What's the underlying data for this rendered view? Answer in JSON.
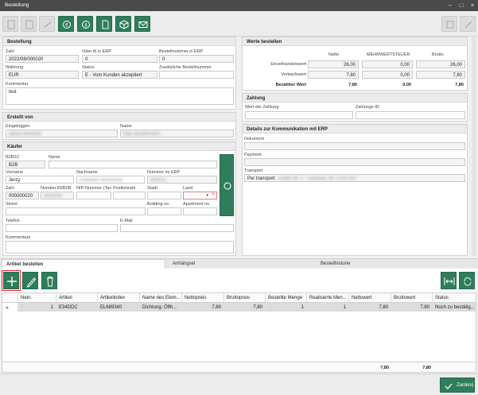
{
  "window": {
    "title": "Bestellung"
  },
  "bestellung": {
    "header": "Bestellung",
    "zahl_label": "Zahl",
    "zahl": "2022/08/000020",
    "order_id_label": "Oder Id in ERP",
    "order_id": "0",
    "bestellnummer_label": "Bestellnummer in ERP",
    "bestellnummer": "0",
    "waehrung_label": "Währung",
    "waehrung": "EUR",
    "status_label": "Status",
    "status": "E - Vom Kunden akzeptiert",
    "zusatz_label": "Zusätzliche Bestellnummer",
    "zusatz": "",
    "kommentar_label": "Kommentar",
    "kommentar": "test"
  },
  "erstellt": {
    "header": "Erstellt von",
    "eingeloggt_label": "Eingeloggen",
    "eingeloggt": "admin.benutzer",
    "name_label": "Name",
    "name": "Max Mustermann"
  },
  "kaeufer": {
    "header": "Käufer",
    "b2b_label": "B2B2C",
    "b2b": "B2B",
    "name_label": "Name",
    "name": "",
    "vorname_label": "Vorname",
    "vorname": "Jerzy",
    "nachname_label": "Nachname",
    "nachname": "Kowalski Nachname",
    "nummer_label": "Nummer im ERP",
    "nummer": "000001",
    "zahl_label": "Zahl",
    "zahl": "000000020",
    "number_b2b_label": "Number B2B2B",
    "number_b2b": "0000000",
    "nip_label": "NIP-Nummer (Tax",
    "nip": "",
    "postleitzahl_label": "Postleitzahl",
    "postleitzahl": "",
    "stadt_label": "Stadt",
    "stadt": "",
    "land_label": "Land",
    "land": "",
    "street_label": "Street",
    "street": "",
    "building_label": "Building no",
    "building": "",
    "apartment_label": "Apartment no",
    "apartment": "",
    "telefon_label": "Telefon",
    "telefon": "",
    "email_label": "E-Mail",
    "email": "",
    "kommentare_label": "Kommentare",
    "kommentare": ""
  },
  "werte": {
    "header": "Werte bestellen",
    "col_netto": "Netto",
    "col_mwst": "MEHRWERTSTEUER",
    "col_brutto": "Brutto",
    "rows": [
      {
        "label": "Einzelhandelswert",
        "netto": "26,00",
        "mwst": "0,00",
        "brutto": "26,00"
      },
      {
        "label": "Verkaufswert",
        "netto": "7,80",
        "mwst": "0,00",
        "brutto": "7,80"
      },
      {
        "label": "Bezahlter Wert",
        "netto": "7,80",
        "mwst": "0,00",
        "brutto": "7,80"
      }
    ]
  },
  "zahlung": {
    "header": "Zahlung",
    "wert_label": "Wert der Zahlung",
    "wert": "",
    "id_label": "Zahlungs-ID",
    "id": ""
  },
  "kommunikation": {
    "header": "Details zur Kommunikation mit ERP",
    "dokument_label": "Dokument",
    "dokument": "",
    "payment_label": "Payment",
    "payment": "",
    "transport_label": "Transport",
    "transport_value": "Per transport",
    "transport_blur": "Kurier Nr. 1 - Lieferant, tel. 0700 000"
  },
  "tabs": [
    "Artikel bestellen",
    "Anhängsel",
    "Bestellhistorie"
  ],
  "grid": {
    "columns": [
      "Nein.",
      "Artikel",
      "Artikelindex",
      "Name des Elem...",
      "Nettopreis",
      "Bruttopreis",
      "Bestellte Menge",
      "Realisierte Men...",
      "Nettowert",
      "Bruttowert",
      "Status"
    ],
    "rows": [
      [
        "1",
        "E34DDC",
        "EL689340",
        "Dichtung, Öffit...",
        "7,80",
        "7,80",
        "1",
        "1",
        "7,80",
        "7,80",
        "Noch zu bestätig..."
      ]
    ],
    "totals": {
      "netto": "7,80",
      "brutto": "7,80"
    }
  },
  "footer": {
    "close_label": "Zamknij"
  }
}
